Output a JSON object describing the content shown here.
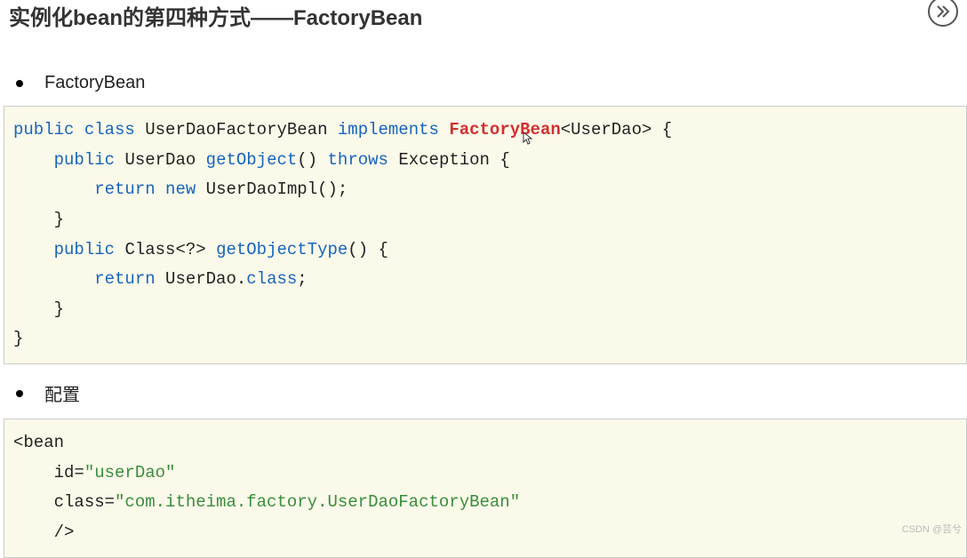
{
  "header": {
    "title": "实例化bean的第四种方式——FactoryBean"
  },
  "bullets": {
    "b1": "FactoryBean",
    "b2": "配置"
  },
  "code1": {
    "l1_public": "public",
    "l1_class": "class",
    "l1_name": "UserDaoFactoryBean",
    "l1_implements": "implements",
    "l1_fb": "FactoryBean",
    "l1_generic": "<UserDao> {",
    "l2_public": "public",
    "l2_ret": "UserDao",
    "l2_method": "getObject",
    "l2_rest": "()",
    "l2_throws": "throws",
    "l2_exc": "Exception {",
    "l3_return": "return",
    "l3_new": "new",
    "l3_rest": "UserDaoImpl();",
    "l4": "    }",
    "l5_public": "public",
    "l5_ret": "Class<?>",
    "l5_method": "getObjectType",
    "l5_rest": "() {",
    "l6_return": "return",
    "l6_rest": "UserDao.",
    "l6_class": "class",
    "l6_semi": ";",
    "l7": "    }",
    "l8": "}"
  },
  "code2": {
    "l1": "<bean",
    "l2a": "    id=",
    "l2b": "\"userDao\"",
    "l3a": "    class=",
    "l3b": "\"com.itheima.factory.UserDaoFactoryBean\"",
    "l4": "    />"
  },
  "watermark": "CSDN @芸兮"
}
